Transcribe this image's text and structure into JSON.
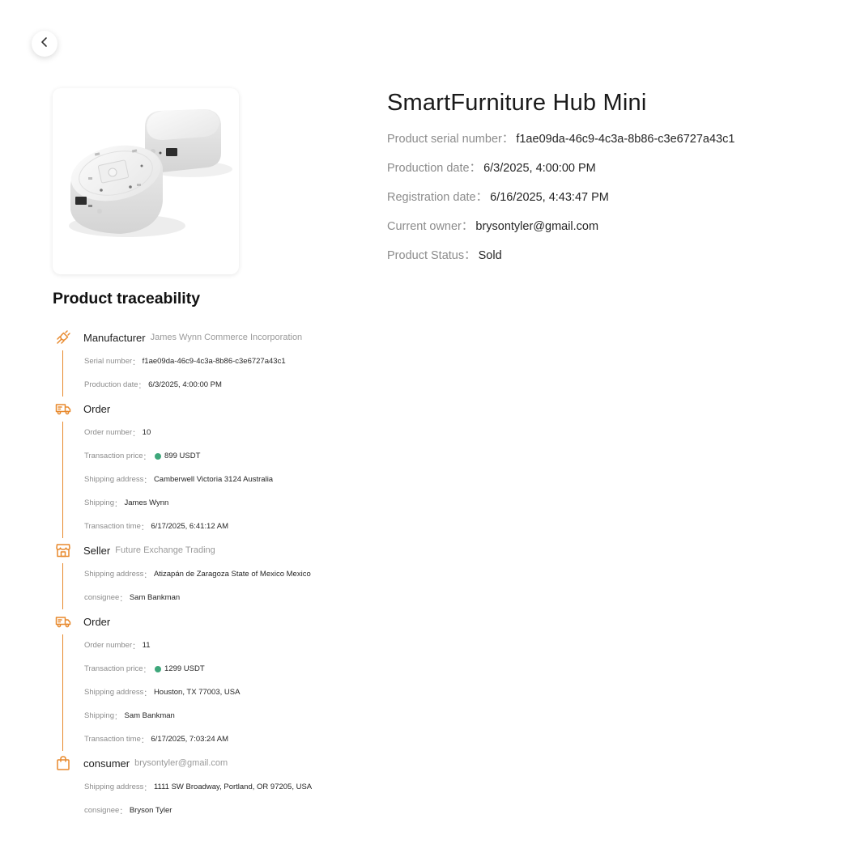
{
  "product": {
    "title": "SmartFurniture Hub Mini",
    "image_alt": "SmartFurniture Hub Mini device",
    "info": [
      {
        "label": "Product serial number",
        "value": "f1ae09da-46c9-4c3a-8b86-c3e6727a43c1"
      },
      {
        "label": "Production date",
        "value": "6/3/2025, 4:00:00 PM"
      },
      {
        "label": "Registration date",
        "value": "6/16/2025, 4:43:47 PM"
      },
      {
        "label": "Current owner",
        "value": "brysontyler@gmail.com"
      },
      {
        "label": "Product Status",
        "value": "Sold"
      }
    ]
  },
  "separator": "：",
  "traceability": {
    "title": "Product traceability",
    "accent_color": "#e8892d",
    "coin_color": "#3ea77b",
    "steps": [
      {
        "icon": "plug-icon",
        "title": "Manufacturer",
        "subtitle": "James Wynn Commerce Incorporation",
        "rows": [
          {
            "label": "Serial number",
            "value": "f1ae09da-46c9-4c3a-8b86-c3e6727a43c1"
          },
          {
            "label": "Production date",
            "value": "6/3/2025, 4:00:00 PM"
          }
        ]
      },
      {
        "icon": "truck-icon",
        "title": "Order",
        "subtitle": "",
        "rows": [
          {
            "label": "Order number",
            "value": "10"
          },
          {
            "label": "Transaction price",
            "value": "899 USDT",
            "coin": true
          },
          {
            "label": "Shipping address",
            "value": "Camberwell Victoria 3124 Australia"
          },
          {
            "label": "Shipping",
            "value": "James Wynn"
          },
          {
            "label": "Transaction time",
            "value": "6/17/2025, 6:41:12 AM"
          }
        ]
      },
      {
        "icon": "store-icon",
        "title": "Seller",
        "subtitle": "Future Exchange Trading",
        "rows": [
          {
            "label": "Shipping address",
            "value": "Atizapán de Zaragoza State of Mexico Mexico"
          },
          {
            "label": "consignee",
            "value": "Sam Bankman"
          }
        ]
      },
      {
        "icon": "truck-icon",
        "title": "Order",
        "subtitle": "",
        "rows": [
          {
            "label": "Order number",
            "value": "11"
          },
          {
            "label": "Transaction price",
            "value": "1299 USDT",
            "coin": true
          },
          {
            "label": "Shipping address",
            "value": "Houston, TX 77003, USA"
          },
          {
            "label": "Shipping",
            "value": "Sam Bankman"
          },
          {
            "label": "Transaction time",
            "value": "6/17/2025, 7:03:24 AM"
          }
        ]
      },
      {
        "icon": "shopping-bag-icon",
        "title": "consumer",
        "subtitle": "brysontyler@gmail.com",
        "rows": [
          {
            "label": "Shipping address",
            "value": "1111 SW Broadway, Portland, OR 97205, USA"
          },
          {
            "label": "consignee",
            "value": "Bryson Tyler"
          }
        ]
      }
    ]
  }
}
